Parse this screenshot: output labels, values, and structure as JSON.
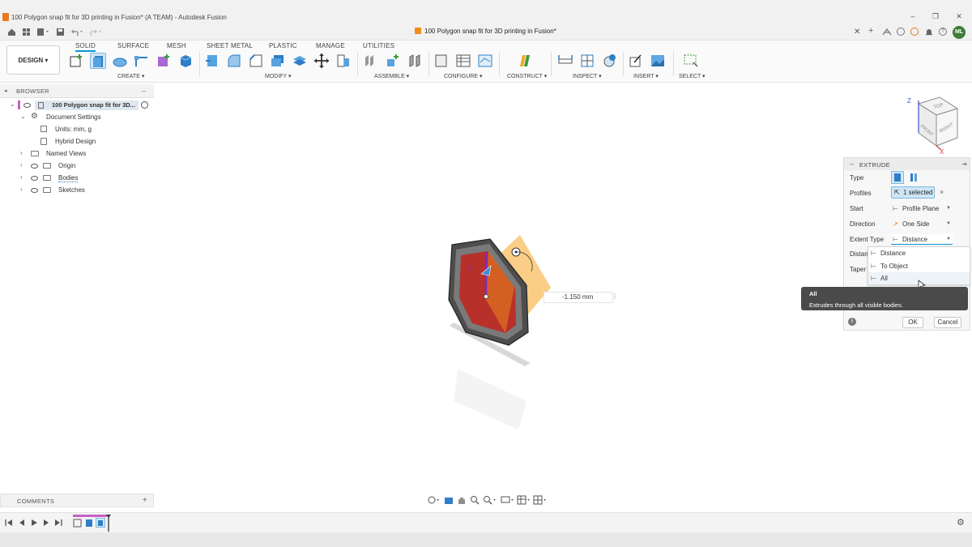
{
  "window": {
    "title": "100 Polygon snap fit for 3D printing in Fusion* (A TEAM) - Autodesk Fusion",
    "minimize": "–",
    "maximize": "❐",
    "close": "✕"
  },
  "tabbar": {
    "document_tab": "100 Polygon snap fit for 3D printing in Fusion*",
    "close": "✕",
    "new_tab": "+",
    "avatar_initials": "ML"
  },
  "toolbar": {
    "workspace_button": "DESIGN ▾",
    "tabs": [
      "SOLID",
      "SURFACE",
      "MESH",
      "SHEET METAL",
      "PLASTIC",
      "MANAGE",
      "UTILITIES"
    ],
    "groups": {
      "create": "CREATE ▾",
      "modify": "MODIFY ▾",
      "assemble": "ASSEMBLE ▾",
      "configure": "CONFIGURE ▾",
      "construct": "CONSTRUCT ▾",
      "inspect": "INSPECT ▾",
      "insert": "INSERT ▾",
      "select": "SELECT ▾"
    }
  },
  "browser": {
    "header": "BROWSER",
    "collapse": "–",
    "items": [
      {
        "label": "100 Polygon snap fit for 3D..."
      },
      {
        "label": "Document Settings"
      },
      {
        "label": "Units: mm, g"
      },
      {
        "label": "Hybrid Design"
      },
      {
        "label": "Named Views"
      },
      {
        "label": "Origin"
      },
      {
        "label": "Bodies"
      },
      {
        "label": "Sketches"
      }
    ]
  },
  "viewport": {
    "dimension_value": "-1.150 mm",
    "small_label": "-1",
    "viewcube": {
      "top": "TOP",
      "front": "FRONT",
      "right": "RIGHT",
      "axis_z": "Z",
      "axis_x": "X"
    }
  },
  "extrude": {
    "title": "EXTRUDE",
    "rows": {
      "type": "Type",
      "profiles": "Profiles",
      "start": "Start",
      "direction": "Direction",
      "extent_type": "Extent Type",
      "distance": "Distan",
      "taper": "Taper"
    },
    "values": {
      "profiles": "1 selected",
      "start": "Profile Plane",
      "direction": "One Side",
      "extent_type": "Distance"
    },
    "dropdown_options": [
      "Distance",
      "To Object",
      "All"
    ],
    "tooltip": {
      "title": "All",
      "text": "Extrudes through all visible bodies."
    },
    "ok": "OK",
    "cancel": "Cancel",
    "info": "i"
  },
  "comments": {
    "label": "COMMENTS",
    "add": "+"
  },
  "colors": {
    "accent": "#0696d7",
    "body_fill": "#b8302a",
    "orange": "#f5a623",
    "dark": "#4a4a4a"
  }
}
